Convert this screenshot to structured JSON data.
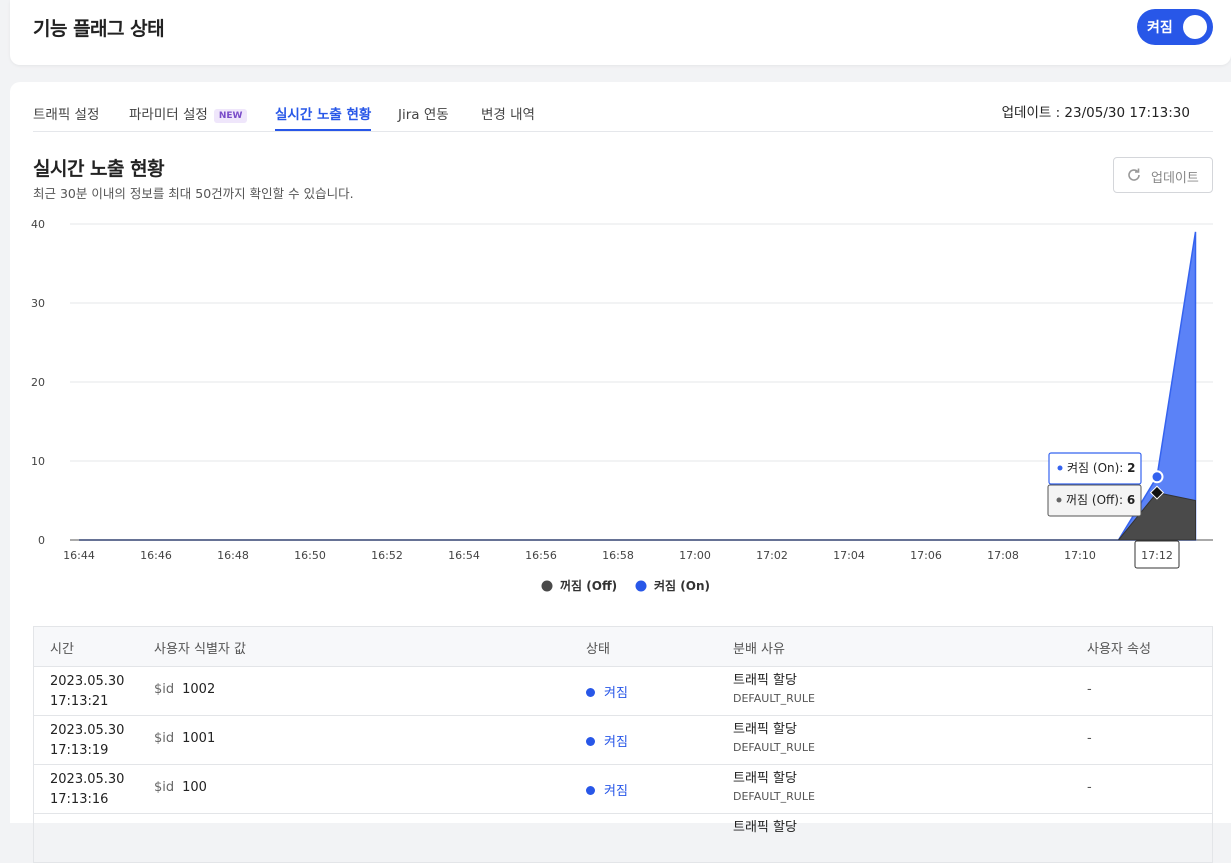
{
  "header": {
    "title": "기능 플래그 상태",
    "toggle_label": "켜짐",
    "toggle_on": true
  },
  "tabs": [
    {
      "label": "트래픽 설정"
    },
    {
      "label": "파라미터 설정",
      "badge": "NEW"
    },
    {
      "label": "실시간 노출 현황",
      "active": true
    },
    {
      "label": "Jira 연동"
    },
    {
      "label": "변경 내역"
    }
  ],
  "updated_at": "업데이트 : 23/05/30 17:13:30",
  "section": {
    "title": "실시간 노출 현황",
    "description": "최근 30분 이내의 정보를 최대 50건까지 확인할 수 있습니다.",
    "refresh_label": "업데이트"
  },
  "colors": {
    "accent": "#2857e8",
    "on_series": "#5b82f7",
    "off_series": "#4a4a4a"
  },
  "chart_data": {
    "type": "area",
    "stacked": true,
    "x": [
      "16:44",
      "16:45",
      "16:46",
      "16:47",
      "16:48",
      "16:49",
      "16:50",
      "16:51",
      "16:52",
      "16:53",
      "16:54",
      "16:55",
      "16:56",
      "16:57",
      "16:58",
      "16:59",
      "17:00",
      "17:01",
      "17:02",
      "17:03",
      "17:04",
      "17:05",
      "17:06",
      "17:07",
      "17:08",
      "17:09",
      "17:10",
      "17:11",
      "17:12",
      "17:13"
    ],
    "x_ticks": [
      "16:44",
      "16:46",
      "16:48",
      "16:50",
      "16:52",
      "16:54",
      "16:56",
      "16:58",
      "17:00",
      "17:02",
      "17:04",
      "17:06",
      "17:08",
      "17:10"
    ],
    "ylim": [
      0,
      40
    ],
    "y_ticks": [
      0,
      10,
      20,
      30,
      40
    ],
    "series": [
      {
        "name": "꺼짐 (Off)",
        "values": [
          0,
          0,
          0,
          0,
          0,
          0,
          0,
          0,
          0,
          0,
          0,
          0,
          0,
          0,
          0,
          0,
          0,
          0,
          0,
          0,
          0,
          0,
          0,
          0,
          0,
          0,
          0,
          0,
          6,
          5
        ]
      },
      {
        "name": "켜짐 (On)",
        "values": [
          0,
          0,
          0,
          0,
          0,
          0,
          0,
          0,
          0,
          0,
          0,
          0,
          0,
          0,
          0,
          0,
          0,
          0,
          0,
          0,
          0,
          0,
          0,
          0,
          0,
          0,
          0,
          0,
          2,
          34
        ]
      }
    ],
    "grid": true,
    "legend": "bottom-center",
    "hover": {
      "x": "17:12",
      "items": [
        {
          "label": "켜짐 (On): ",
          "value": "2"
        },
        {
          "label": "꺼짐 (Off): ",
          "value": "6"
        }
      ]
    }
  },
  "table": {
    "columns": [
      "시간",
      "사용자 식별자 값",
      "상태",
      "분배 사유",
      "사용자 속성"
    ],
    "rows": [
      {
        "date": "2023.05.30",
        "time": "17:13:21",
        "id_label": "$id",
        "id_value": "1002",
        "state": "켜짐",
        "reason": "트래픽 할당",
        "reason_code": "DEFAULT_RULE",
        "attr": "-"
      },
      {
        "date": "2023.05.30",
        "time": "17:13:19",
        "id_label": "$id",
        "id_value": "1001",
        "state": "켜짐",
        "reason": "트래픽 할당",
        "reason_code": "DEFAULT_RULE",
        "attr": "-"
      },
      {
        "date": "2023.05.30",
        "time": "17:13:16",
        "id_label": "$id",
        "id_value": "100",
        "state": "켜짐",
        "reason": "트래픽 할당",
        "reason_code": "DEFAULT_RULE",
        "attr": "-"
      },
      {
        "date": "",
        "time": "",
        "id_label": "",
        "id_value": "",
        "state": "",
        "reason": "트래픽 할당",
        "reason_code": "",
        "attr": ""
      }
    ]
  }
}
